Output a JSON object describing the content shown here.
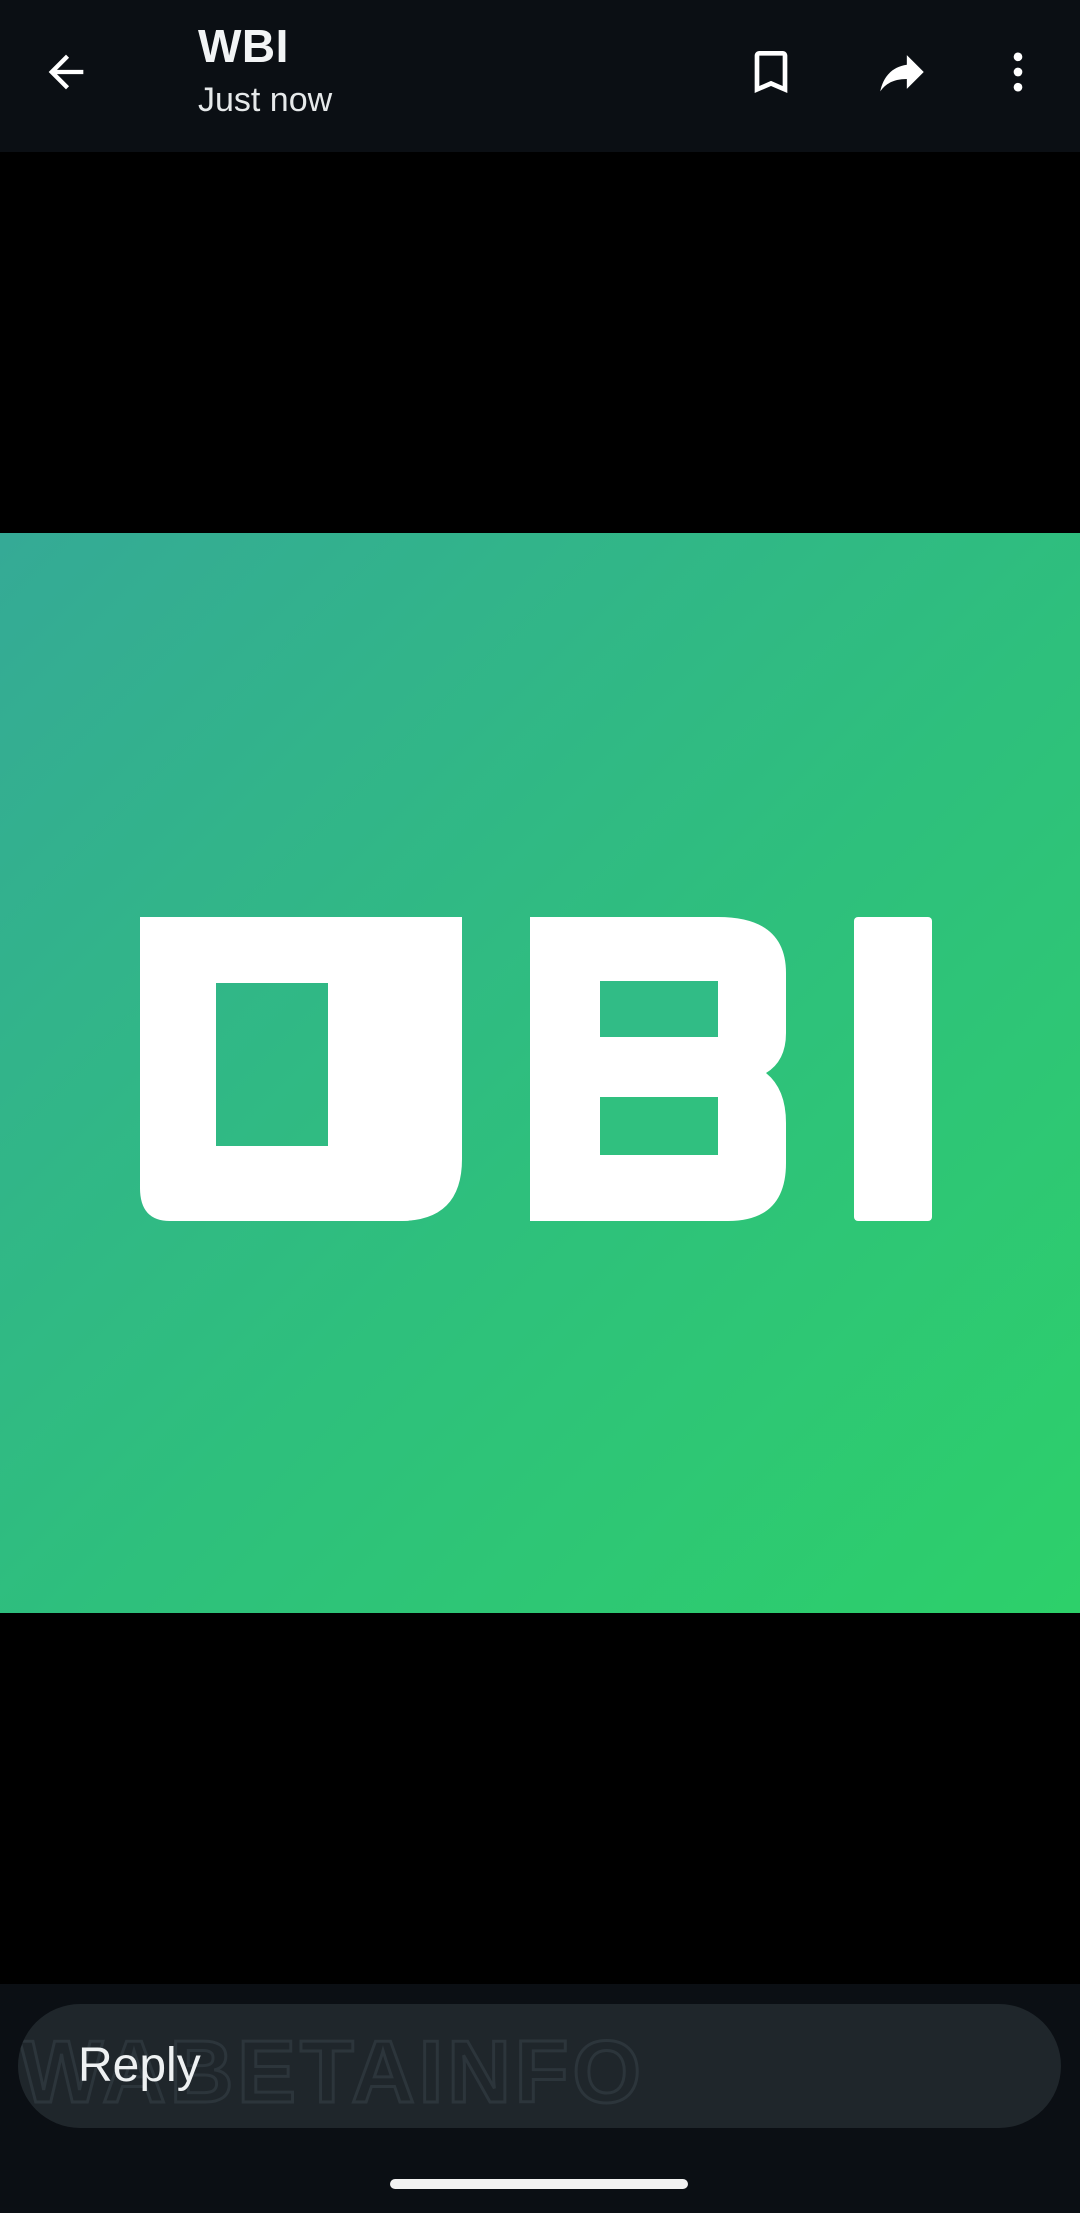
{
  "header": {
    "title": "WBI",
    "subtitle": "Just now",
    "icons": {
      "back": "arrow-left-icon",
      "bookmark": "bookmark-icon",
      "forward": "forward-icon",
      "menu": "more-vertical-icon"
    }
  },
  "media": {
    "logo_text": "WBI",
    "gradient_colors": [
      "#35aa96",
      "#2dd06a"
    ]
  },
  "reply": {
    "label": "Reply",
    "watermark": "WABETAINFO"
  },
  "colors": {
    "header_bg": "#0b0f14",
    "reply_bg": "#1f262b",
    "text": "#f2f4f5"
  }
}
